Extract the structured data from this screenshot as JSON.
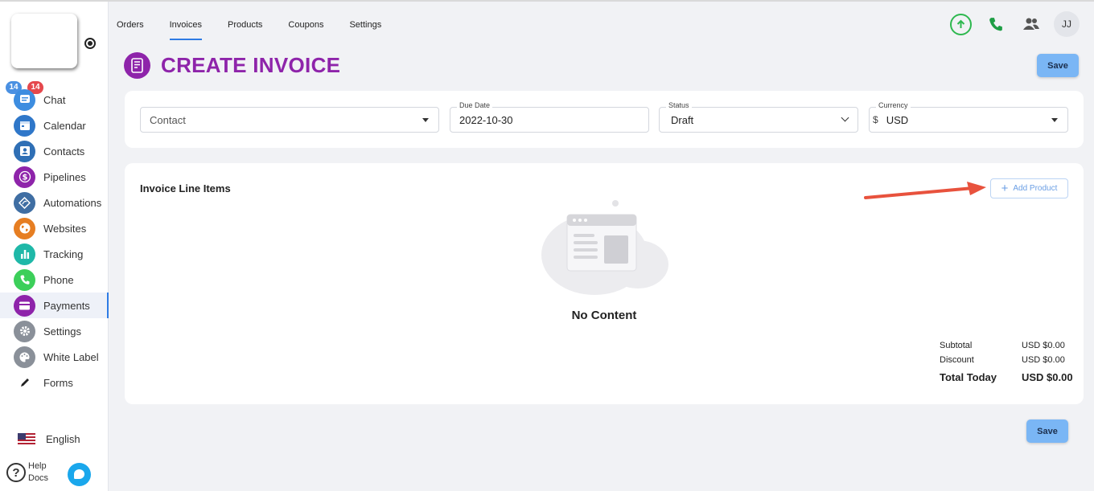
{
  "sidebar": {
    "badges": {
      "blue": "14",
      "red": "14"
    },
    "items": [
      {
        "label": "Chat",
        "icon": "chat-icon",
        "color": "#3d8de0"
      },
      {
        "label": "Calendar",
        "icon": "calendar-icon",
        "color": "#2f77c9"
      },
      {
        "label": "Contacts",
        "icon": "contacts-icon",
        "color": "#2f6fb5"
      },
      {
        "label": "Pipelines",
        "icon": "dollar-icon",
        "color": "#8e24aa"
      },
      {
        "label": "Automations",
        "icon": "automation-icon",
        "color": "#3f6ea3"
      },
      {
        "label": "Websites",
        "icon": "globe-icon",
        "color": "#e67e22"
      },
      {
        "label": "Tracking",
        "icon": "bar-chart-icon",
        "color": "#1fb8a8"
      },
      {
        "label": "Phone",
        "icon": "phone-icon",
        "color": "#3ccf5a"
      },
      {
        "label": "Payments",
        "icon": "credit-card-icon",
        "color": "#8e24aa",
        "active": true
      },
      {
        "label": "Settings",
        "icon": "gear-icon",
        "color": "#8a9099"
      },
      {
        "label": "White Label",
        "icon": "palette-icon",
        "color": "#8a9099"
      },
      {
        "label": "Forms",
        "icon": "pencil-icon",
        "color": "#ffffff"
      }
    ],
    "language": "English",
    "help": {
      "line1": "Help",
      "line2": "Docs"
    }
  },
  "tabs": [
    {
      "label": "Orders"
    },
    {
      "label": "Invoices",
      "active": true
    },
    {
      "label": "Products"
    },
    {
      "label": "Coupons"
    },
    {
      "label": "Settings"
    }
  ],
  "header": {
    "avatar_initials": "JJ"
  },
  "page": {
    "title": "CREATE INVOICE",
    "save_label": "Save"
  },
  "form": {
    "contact": {
      "placeholder": "Contact",
      "value": ""
    },
    "due_date": {
      "label": "Due Date",
      "value": "2022-10-30"
    },
    "status": {
      "label": "Status",
      "value": "Draft"
    },
    "currency": {
      "label": "Currency",
      "symbol": "$",
      "value": "USD"
    }
  },
  "line_items": {
    "title": "Invoice Line Items",
    "add_product_label": "Add Product",
    "empty_text": "No Content"
  },
  "totals": {
    "subtotal_label": "Subtotal",
    "subtotal_value": "USD $0.00",
    "discount_label": "Discount",
    "discount_value": "USD $0.00",
    "total_label": "Total Today",
    "total_value": "USD $0.00"
  },
  "colors": {
    "accent": "#8e24aa",
    "primary_button": "#7ab6f5",
    "annotation_arrow": "#e8523d"
  }
}
